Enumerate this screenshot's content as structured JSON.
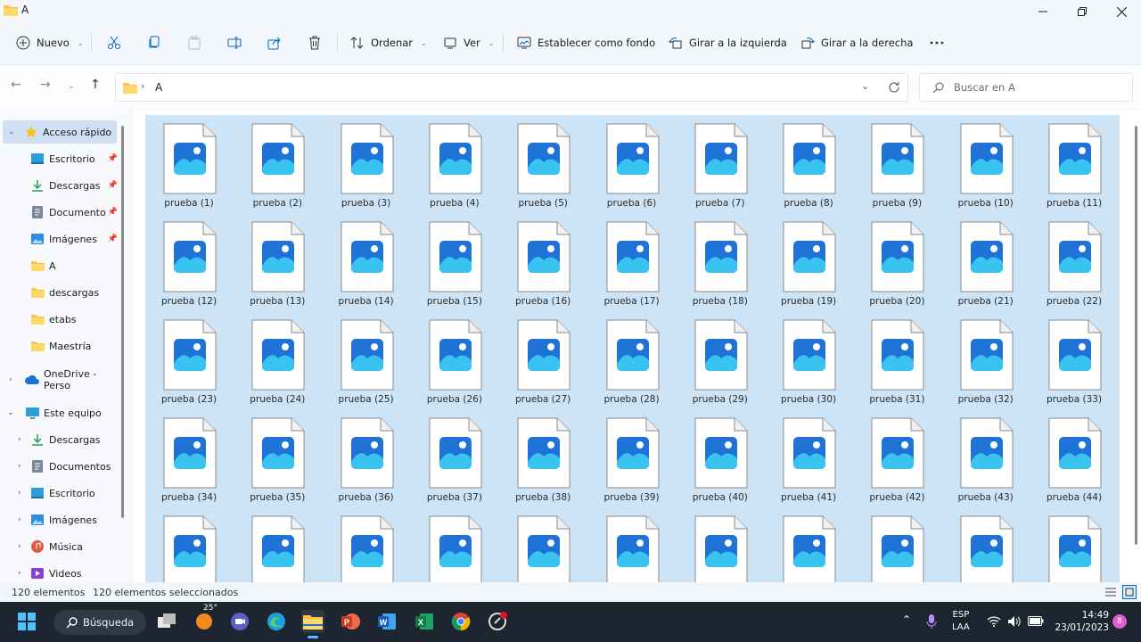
{
  "window": {
    "title": "A"
  },
  "toolbar": {
    "new": "Nuevo",
    "sort": "Ordenar",
    "view": "Ver",
    "set_background": "Establecer como fondo",
    "rotate_left": "Girar a la izquierda",
    "rotate_right": "Girar a la derecha"
  },
  "address": {
    "path": "A"
  },
  "search": {
    "placeholder": "Buscar en A"
  },
  "sidebar": {
    "quick_access": "Acceso rápido",
    "quick_items": [
      "Escritorio",
      "Descargas",
      "Documento",
      "Imágenes",
      "A",
      "descargas",
      "etabs",
      "Maestría"
    ],
    "onedrive": "OneDrive - Perso",
    "this_pc": "Este equipo",
    "pc_items": [
      "Descargas",
      "Documentos",
      "Escritorio",
      "Imágenes",
      "Música",
      "Videos"
    ]
  },
  "files": {
    "labels": [
      "prueba (1)",
      "prueba (2)",
      "prueba (3)",
      "prueba (4)",
      "prueba (5)",
      "prueba (6)",
      "prueba (7)",
      "prueba (8)",
      "prueba (9)",
      "prueba (10)",
      "prueba (11)",
      "prueba (12)",
      "prueba (13)",
      "prueba (14)",
      "prueba (15)",
      "prueba (16)",
      "prueba (17)",
      "prueba (18)",
      "prueba (19)",
      "prueba (20)",
      "prueba (21)",
      "prueba (22)",
      "prueba (23)",
      "prueba (24)",
      "prueba (25)",
      "prueba (26)",
      "prueba (27)",
      "prueba (28)",
      "prueba (29)",
      "prueba (30)",
      "prueba (31)",
      "prueba (32)",
      "prueba (33)",
      "prueba (34)",
      "prueba (35)",
      "prueba (36)",
      "prueba (37)",
      "prueba (38)",
      "prueba (39)",
      "prueba (40)",
      "prueba (41)",
      "prueba (42)",
      "prueba (43)",
      "prueba (44)"
    ],
    "partial_row_count": 11
  },
  "status": {
    "count": "120 elementos",
    "selected": "120 elementos seleccionados"
  },
  "taskbar": {
    "search": "Búsqueda",
    "weather": "25°",
    "lang_line1": "ESP",
    "lang_line2": "LAA",
    "time": "14:49",
    "date": "23/01/2023",
    "notif_count": "8"
  },
  "colors": {
    "selection": "#cde4f7",
    "accent": "#0067c0",
    "folder": "#f8c44f",
    "taskbar": "#1c2530"
  }
}
